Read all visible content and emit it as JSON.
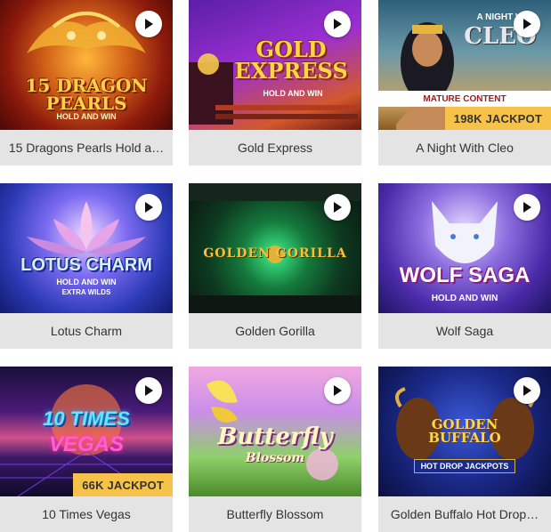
{
  "games": [
    {
      "name": "15 Dragons Pearls Hold a…",
      "art_title": "15 DRAGON PEARLS",
      "art_sub": "HOLD AND WIN"
    },
    {
      "name": "Gold Express",
      "art_title": "GOLD EXPRESS",
      "art_sub": "HOLD AND WIN"
    },
    {
      "name": "A Night With Cleo",
      "art_title": "CLEO",
      "art_top": "A NIGHT W",
      "mature": "MATURE CONTENT",
      "jackpot": "198K JACKPOT"
    },
    {
      "name": "Lotus Charm",
      "art_title": "LOTUS CHARM",
      "art_sub": "HOLD AND WIN",
      "art_sub2": "EXTRA WILDS"
    },
    {
      "name": "Golden Gorilla",
      "art_title": "GOLDEN GORILLA"
    },
    {
      "name": "Wolf Saga",
      "art_title": "WOLF SAGA",
      "art_sub": "HOLD AND WIN"
    },
    {
      "name": "10 Times Vegas",
      "art_title": "10 TIMES",
      "art_title2": "VEGAS",
      "jackpot": "66K JACKPOT"
    },
    {
      "name": "Butterfly Blossom",
      "art_title": "Butterfly",
      "art_title2": "Blossom"
    },
    {
      "name": "Golden Buffalo Hot Drop…",
      "art_title": "GOLDEN BUFFALO",
      "art_sub": "HOT DROP JACKPOTS"
    }
  ],
  "icons": {
    "play": "play-circle-icon"
  },
  "colors": {
    "caption_bg": "#e4e4e4",
    "jackpot_bg": "#f7c24a",
    "text": "#333333"
  }
}
